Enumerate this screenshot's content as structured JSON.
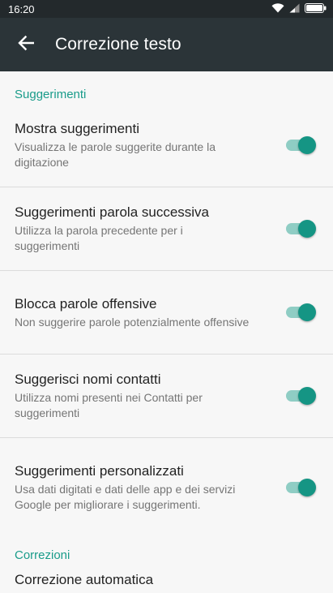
{
  "status_bar": {
    "time": "16:20"
  },
  "app_bar": {
    "title": "Correzione testo"
  },
  "sections": {
    "suggestions_header": "Suggerimenti",
    "corrections_header": "Correzioni"
  },
  "settings": [
    {
      "title": "Mostra suggerimenti",
      "summary": "Visualizza le parole suggerite durante la digitazione",
      "enabled": true
    },
    {
      "title": "Suggerimenti parola successiva",
      "summary": "Utilizza la parola precedente per i suggerimenti",
      "enabled": true
    },
    {
      "title": "Blocca parole offensive",
      "summary": "Non suggerire parole potenzialmente offensive",
      "enabled": true
    },
    {
      "title": "Suggerisci nomi contatti",
      "summary": "Utilizza nomi presenti nei Contatti per suggerimenti",
      "enabled": true
    },
    {
      "title": "Suggerimenti personalizzati",
      "summary": "Usa dati digitati e dati delle app e dei servizi Google per migliorare i suggerimenti.",
      "enabled": true
    }
  ],
  "partial_item": {
    "title": "Correzione automatica"
  },
  "icons": {
    "back": "arrow-back-icon",
    "wifi": "wifi-icon",
    "signal": "cell-signal-icon",
    "battery": "battery-icon"
  },
  "colors": {
    "accent": "#1a9c8a",
    "toggle_thumb": "#159584",
    "toggle_track": "#8fcdc4",
    "app_bar": "#2b3438",
    "status_bar": "#23292c"
  }
}
